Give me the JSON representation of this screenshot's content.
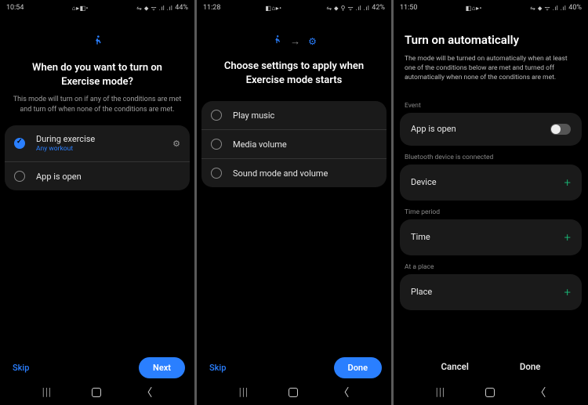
{
  "screens": [
    {
      "status": {
        "time": "10:54",
        "left_icons": "⌂▸◧•",
        "right_icons": "⇋ ⬥ ᯤ .ıl .ıl",
        "battery": "44%"
      },
      "mode_icons": {
        "running": "🏃"
      },
      "heading": "When do you want to turn on Exercise mode?",
      "subtext": "This mode will turn on if any of the conditions are met and turn off when none of the conditions are met.",
      "options": [
        {
          "label": "During exercise",
          "sub": "Any workout",
          "checked": true,
          "gear": true
        },
        {
          "label": "App is open",
          "checked": false
        }
      ],
      "skip": "Skip",
      "primary": "Next"
    },
    {
      "status": {
        "time": "11:28",
        "left_icons": "◧⌂▸•",
        "right_icons": "⇋ ⬥ ⚲ ᯤ .ıl .ıl",
        "battery": "42%"
      },
      "mode_icons": {
        "running": "🏃",
        "arrow": "→",
        "gear": "⚙"
      },
      "heading": "Choose settings to apply when Exercise mode starts",
      "options": [
        {
          "label": "Play music"
        },
        {
          "label": "Media volume"
        },
        {
          "label": "Sound mode and volume"
        }
      ],
      "skip": "Skip",
      "primary": "Done"
    },
    {
      "status": {
        "time": "11:50",
        "left_icons": "◧⌂▸•",
        "right_icons": "⇋ ⬥ ᯤ .ıl .ıl",
        "battery": "40%"
      },
      "heading": "Turn on automatically",
      "subtext": "The mode will be turned on automatically when at least one of the conditions below are met and turned off automatically when none of the conditions are met.",
      "sections": [
        {
          "label": "Event",
          "row": "App is open",
          "control": "toggle"
        },
        {
          "label": "Bluetooth device is connected",
          "row": "Device",
          "control": "plus"
        },
        {
          "label": "Time period",
          "row": "Time",
          "control": "plus"
        },
        {
          "label": "At a place",
          "row": "Place",
          "control": "plus"
        }
      ],
      "cancel": "Cancel",
      "done": "Done"
    }
  ]
}
